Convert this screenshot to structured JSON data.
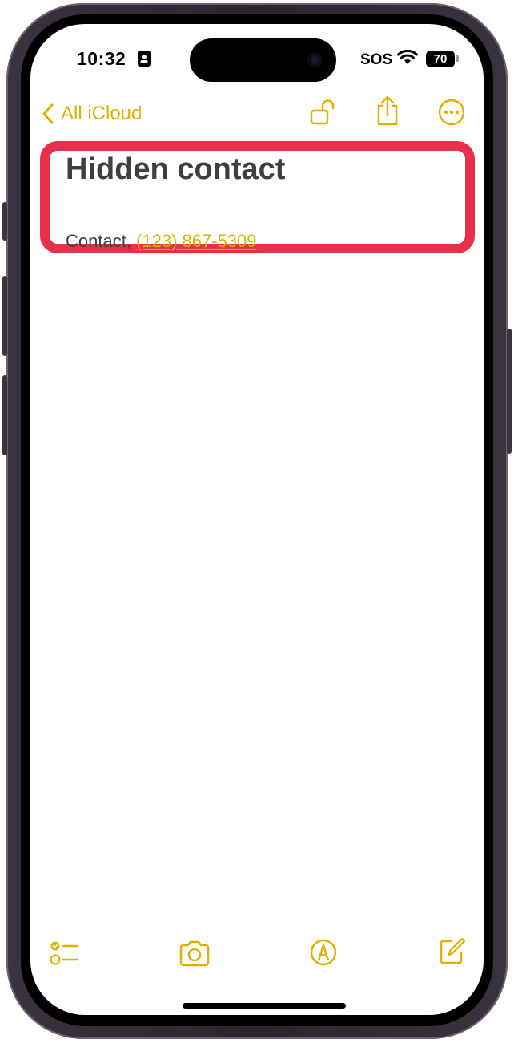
{
  "status_bar": {
    "time": "10:32",
    "carrier": "SOS",
    "battery": "70"
  },
  "nav": {
    "back_label": "All iCloud"
  },
  "note": {
    "title": "Hidden contact",
    "body_prefix": "Contact, ",
    "phone_link": "(123) 867-5309"
  },
  "icons": {
    "back": "chevron-left-icon",
    "lock": "unlock-icon",
    "share": "share-icon",
    "more": "more-icon",
    "checklist": "checklist-icon",
    "camera": "camera-icon",
    "markup": "markup-icon",
    "compose": "compose-icon"
  },
  "colors": {
    "accent": "#e2b000",
    "highlight": "#e8304a",
    "text": "#3f3f3f"
  }
}
